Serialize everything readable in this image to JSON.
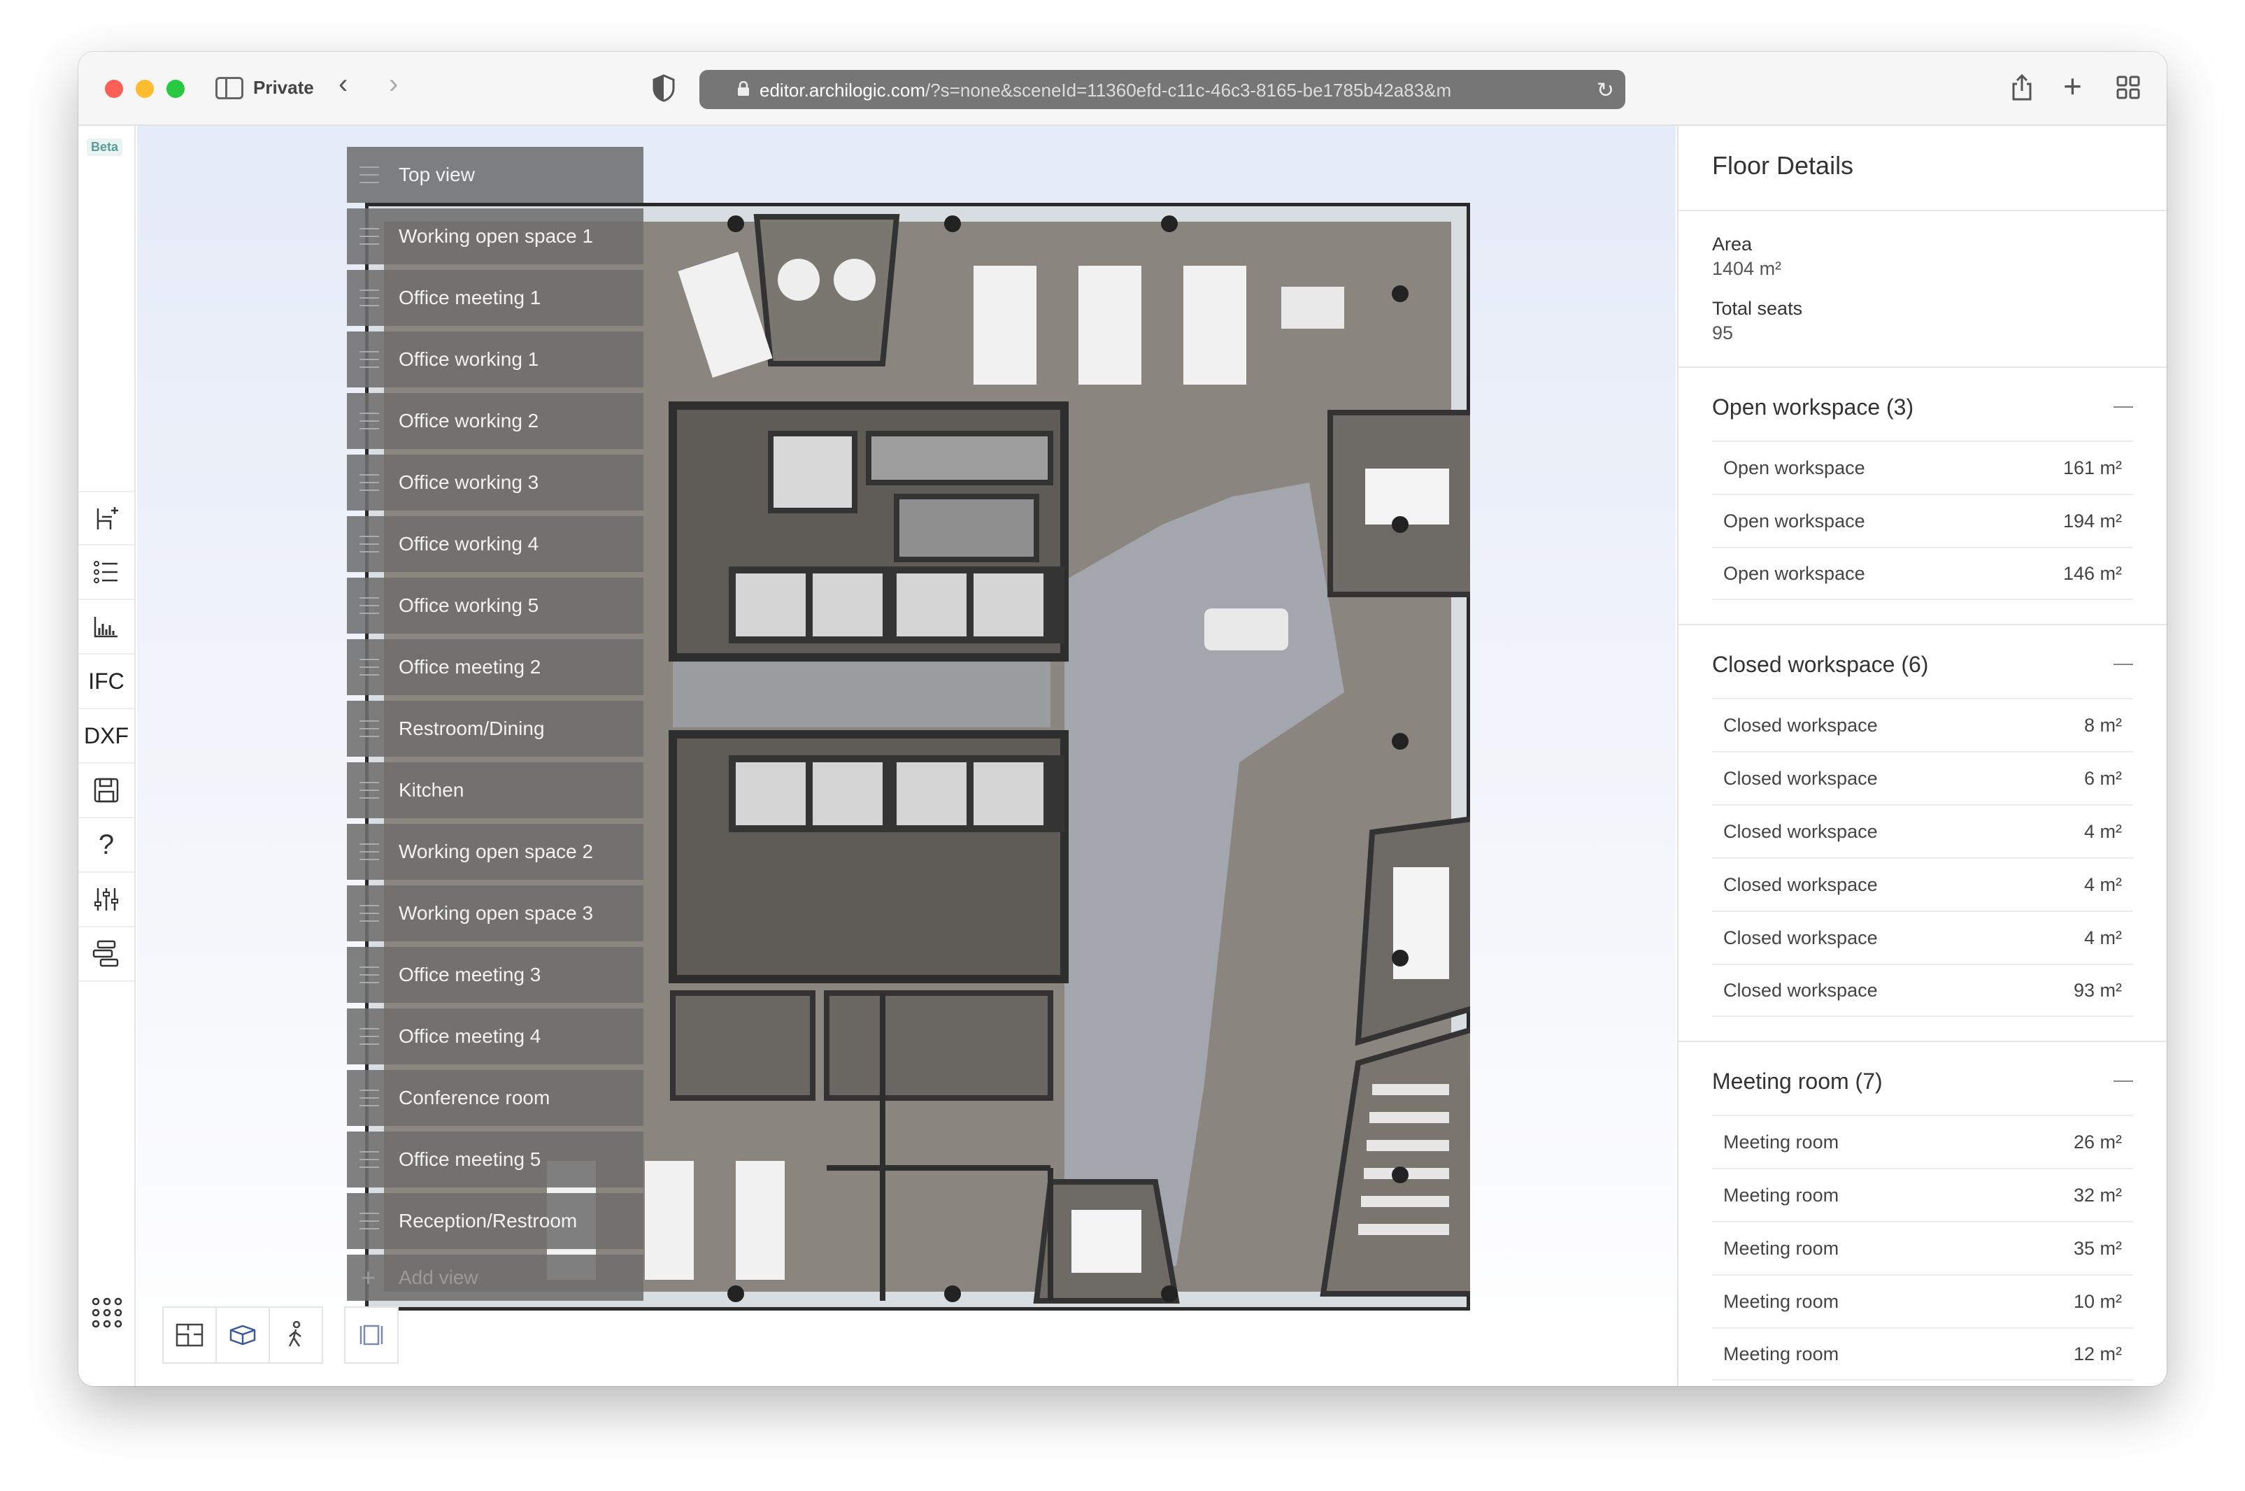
{
  "browser": {
    "private_label": "Private",
    "url_main": "editor.archilogic.com",
    "url_rest": "/?s=none&sceneId=11360efd-c11c-46c3-8165-be1785b42a83&m"
  },
  "leftbar": {
    "beta": "Beta",
    "ifc": "IFC",
    "dxf": "DXF"
  },
  "views": {
    "items": [
      "Top view",
      "Working open space 1",
      "Office meeting 1",
      "Office working 1",
      "Office working 2",
      "Office working 3",
      "Office working 4",
      "Office working 5",
      "Office meeting 2",
      "Restroom/Dining",
      "Kitchen",
      "Working open space 2",
      "Working open space 3",
      "Office meeting 3",
      "Office meeting 4",
      "Conference room",
      "Office meeting 5",
      "Reception/Restroom"
    ],
    "add_label": "Add view"
  },
  "sidebar": {
    "title": "Floor Details",
    "area_label": "Area",
    "area_value": "1404 m²",
    "seats_label": "Total seats",
    "seats_value": "95",
    "sections": [
      {
        "title": "Open workspace (3)",
        "rows": [
          {
            "name": "Open workspace",
            "value": "161 m²"
          },
          {
            "name": "Open workspace",
            "value": "194 m²"
          },
          {
            "name": "Open workspace",
            "value": "146 m²"
          }
        ]
      },
      {
        "title": "Closed workspace (6)",
        "rows": [
          {
            "name": "Closed workspace",
            "value": "8 m²"
          },
          {
            "name": "Closed workspace",
            "value": "6 m²"
          },
          {
            "name": "Closed workspace",
            "value": "4 m²"
          },
          {
            "name": "Closed workspace",
            "value": "4 m²"
          },
          {
            "name": "Closed workspace",
            "value": "4 m²"
          },
          {
            "name": "Closed workspace",
            "value": "93 m²"
          }
        ]
      },
      {
        "title": "Meeting room (7)",
        "rows": [
          {
            "name": "Meeting room",
            "value": "26 m²"
          },
          {
            "name": "Meeting room",
            "value": "32 m²"
          },
          {
            "name": "Meeting room",
            "value": "35 m²"
          },
          {
            "name": "Meeting room",
            "value": "10 m²"
          },
          {
            "name": "Meeting room",
            "value": "12 m²"
          }
        ]
      }
    ]
  }
}
